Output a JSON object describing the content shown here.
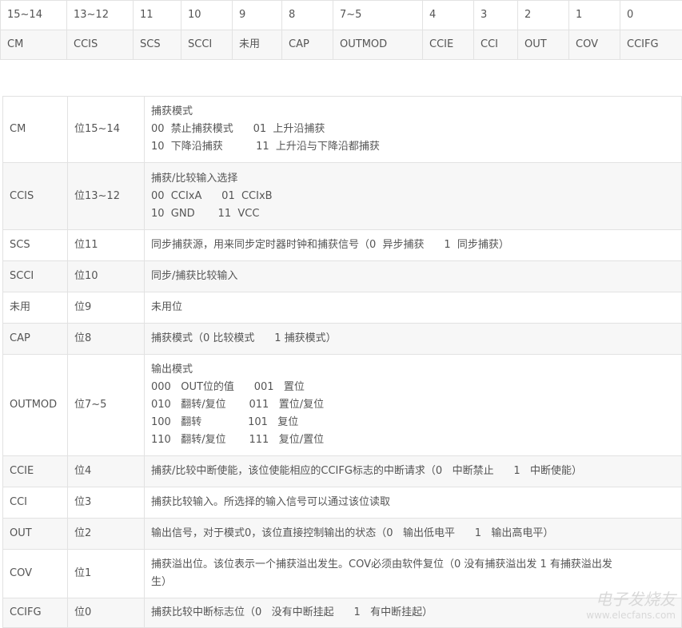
{
  "bit_table": {
    "bits": [
      "15~14",
      "13~12",
      "11",
      "10",
      "9",
      "8",
      "7~5",
      "4",
      "3",
      "2",
      "1",
      "0"
    ],
    "names": [
      "CM",
      "CCIS",
      "SCS",
      "SCCI",
      "未用",
      "CAP",
      "OUTMOD",
      "CCIE",
      "CCI",
      "OUT",
      "COV",
      "CCIFG"
    ]
  },
  "desc_table": [
    {
      "name": "CM",
      "bit": "位15~14",
      "lines": [
        "捕获模式",
        "00  禁止捕获模式      01  上升沿捕获",
        "10  下降沿捕获          11  上升沿与下降沿都捕获"
      ]
    },
    {
      "name": "CCIS",
      "bit": "位13~12",
      "lines": [
        "捕获/比较输入选择",
        "00  CCIxA      01  CCIxB",
        "10  GND       11  VCC"
      ]
    },
    {
      "name": "SCS",
      "bit": "位11",
      "lines": [
        "同步捕获源，用来同步定时器时钟和捕获信号（0  异步捕获      1  同步捕获）"
      ]
    },
    {
      "name": "SCCI",
      "bit": "位10",
      "lines": [
        "同步/捕获比较输入"
      ]
    },
    {
      "name": "未用",
      "bit": "位9",
      "lines": [
        "未用位"
      ]
    },
    {
      "name": "CAP",
      "bit": "位8",
      "lines": [
        "捕获模式（0 比较模式      1 捕获模式）"
      ]
    },
    {
      "name": "OUTMOD",
      "bit": "位7~5",
      "lines": [
        "输出模式",
        "000   OUT位的值      001   置位",
        "010   翻转/复位       011   置位/复位",
        "100   翻转              101   复位",
        "110   翻转/复位       111   复位/置位"
      ]
    },
    {
      "name": "CCIE",
      "bit": "位4",
      "lines": [
        "捕获/比较中断使能，该位使能相应的CCIFG标志的中断请求（0   中断禁止      1   中断使能）"
      ]
    },
    {
      "name": "CCI",
      "bit": "位3",
      "lines": [
        "捕获比较输入。所选择的输入信号可以通过该位读取"
      ]
    },
    {
      "name": "OUT",
      "bit": "位2",
      "lines": [
        "输出信号，对于模式0，该位直接控制输出的状态（0   输出低电平      1   输出高电平）"
      ]
    },
    {
      "name": "COV",
      "bit": "位1",
      "lines": [
        "捕获溢出位。该位表示一个捕获溢出发生。COV必须由软件复位（0   没有捕获溢出发      1   有捕获溢出发",
        "生）"
      ]
    },
    {
      "name": "CCIFG",
      "bit": "位0",
      "lines": [
        "捕获比较中断标志位（0   没有中断挂起      1   有中断挂起）"
      ]
    }
  ],
  "watermark": {
    "brand": "电子发烧友",
    "url": "www.elecfans.com"
  }
}
